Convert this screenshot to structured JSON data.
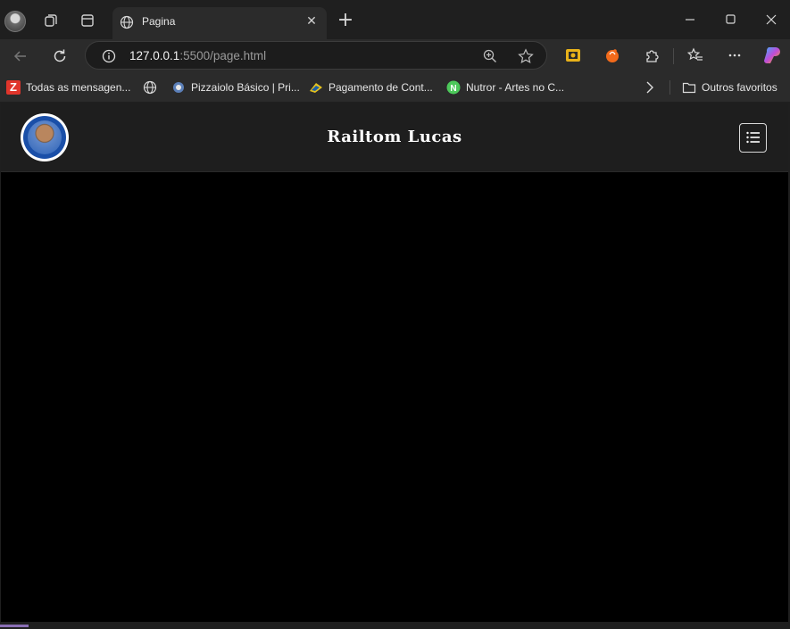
{
  "tab": {
    "title": "Pagina"
  },
  "address_bar": {
    "host": "127.0.0.1",
    "path": ":5500/page.html"
  },
  "bookmarks": [
    {
      "label": "Todas as mensagen..."
    },
    {
      "label": ""
    },
    {
      "label": "Pizzaiolo Básico | Pri..."
    },
    {
      "label": "Pagamento de Cont..."
    },
    {
      "label": "Nutror - Artes no C..."
    }
  ],
  "bookmarks_overflow": {
    "label": "Outros favoritos"
  },
  "page": {
    "site_title": "Railtom Lucas",
    "background": "#000000",
    "header_background": "#1e1e1e"
  },
  "colors": {
    "browser_chrome": "#2b2b2b",
    "tabstrip": "#1f1f1f",
    "text": "#e6e6e6"
  }
}
